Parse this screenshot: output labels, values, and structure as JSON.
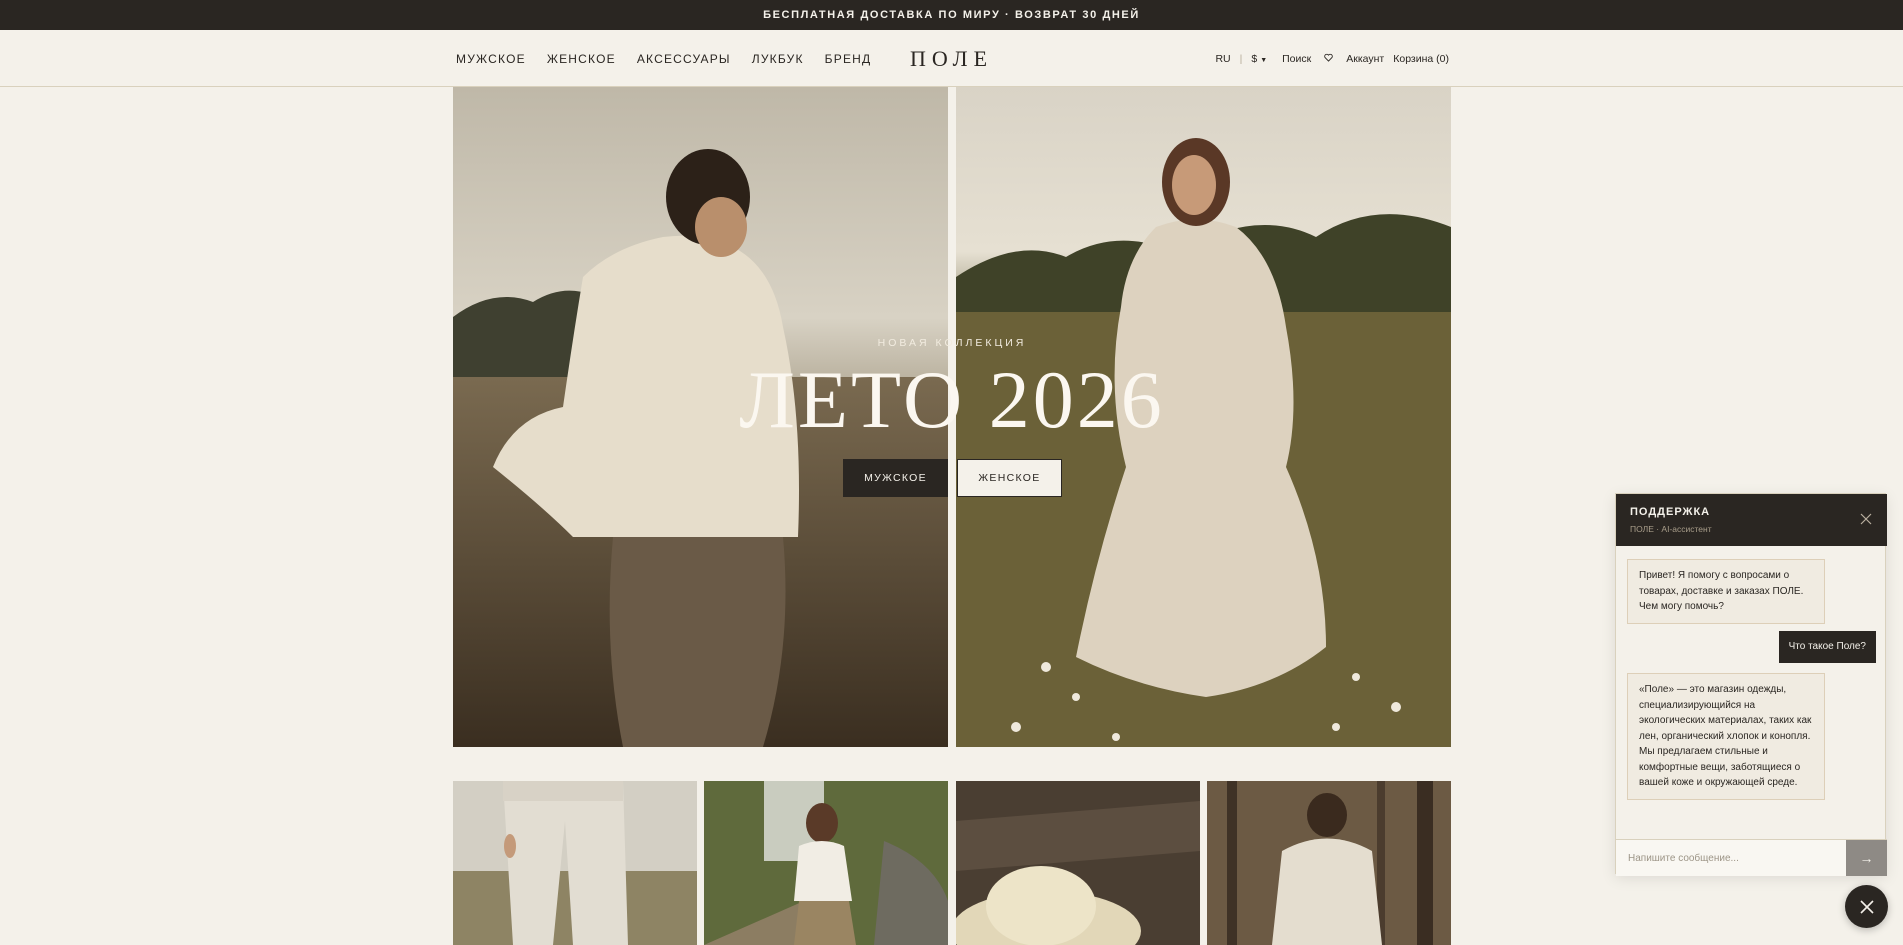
{
  "announcement": "БЕСПЛАТНАЯ ДОСТАВКА ПО МИРУ · ВОЗВРАТ 30 ДНЕЙ",
  "header": {
    "nav": [
      "МУЖСКОЕ",
      "ЖЕНСКОЕ",
      "АКСЕССУАРЫ",
      "ЛУКБУК",
      "БРЕНД"
    ],
    "logo": "ПОЛЕ",
    "lang": "RU",
    "currency": "$",
    "search": "Поиск",
    "wishlist_icon": "heart-icon",
    "account": "Аккаунт",
    "cart": "Корзина (0)"
  },
  "hero": {
    "eyebrow": "НОВАЯ КОЛЛЕКЦИЯ",
    "title": "ЛЕТО 2026",
    "btn_men": "МУЖСКОЕ",
    "btn_women": "ЖЕНСКОЕ"
  },
  "chat": {
    "title": "ПОДДЕРЖКА",
    "subtitle": "ПОЛЕ · AI-ассистент",
    "messages": [
      {
        "role": "bot",
        "text": "Привет! Я помогу с вопросами о товарах, доставке и заказах ПОЛЕ. Чем могу помочь?"
      },
      {
        "role": "user",
        "text": "Что такое Поле?"
      },
      {
        "role": "bot",
        "text": "«Поле» — это магазин одежды, специализирующийся на экологических материалах, таких как лен, органический хлопок и конопля. Мы предлагаем стильные и комфортные вещи, заботящиеся о вашей коже и окружающей среде."
      }
    ],
    "placeholder": "Напишите сообщение...",
    "send": "→"
  },
  "colors": {
    "background": "#f4f1ea",
    "dark": "#2a2622",
    "border": "#d9d1bd"
  }
}
